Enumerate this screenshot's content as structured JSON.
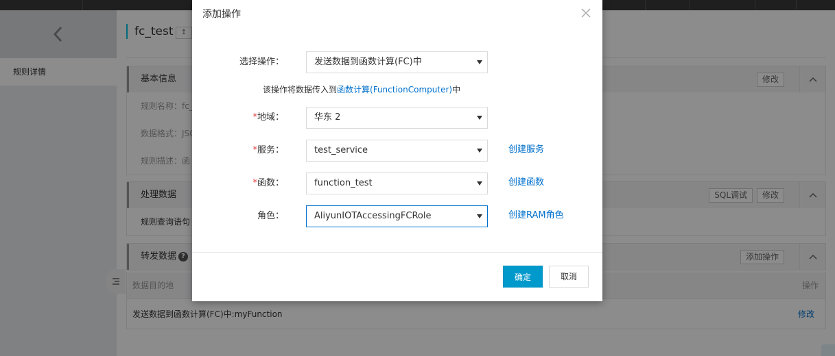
{
  "page": {
    "title": "fc_test",
    "title_btn_glyph": "↥"
  },
  "sidebar": {
    "items": [
      {
        "label": "规则详情"
      }
    ]
  },
  "panels": {
    "basic": {
      "title": "基本信息",
      "edit_label": "修改",
      "rows": [
        "规则名称：fc_",
        "数据格式：JSO",
        "规则描述：函"
      ]
    },
    "process": {
      "title": "处理数据",
      "sql_label": "SQL调试",
      "edit_label": "修改",
      "rows": [
        "规则查询语句"
      ]
    },
    "forward": {
      "title": "转发数据",
      "help_glyph": "?",
      "add_label": "添加操作",
      "table": {
        "headers": [
          "数据目的地",
          "操作"
        ],
        "rows": [
          {
            "destination": "发送数据到函数计算(FC)中:myFunction",
            "action": "修改"
          }
        ]
      }
    }
  },
  "modal": {
    "title": "添加操作",
    "fields": {
      "operation": {
        "label": "选择操作：",
        "value": "发送数据到函数计算(FC)中"
      },
      "hint_prefix": "该操作将数据传入到",
      "hint_link": "函数计算(FunctionComputer)",
      "hint_suffix": "中",
      "region": {
        "required_mark": "*",
        "label": "地域：",
        "value": "华东 2"
      },
      "service": {
        "required_mark": "*",
        "label": "服务：",
        "value": "test_service",
        "link": "创建服务"
      },
      "function": {
        "required_mark": "*",
        "label": "函数：",
        "value": "function_test",
        "link": "创建函数"
      },
      "role": {
        "label": "角色：",
        "value": "AliyunIOTAccessingFCRole",
        "link": "创建RAM角色"
      }
    },
    "ok_label": "确定",
    "cancel_label": "取消"
  },
  "colors": {
    "primary": "#0099cc",
    "link": "#0070cc",
    "required": "#e4393c",
    "accent": "#00c1de"
  }
}
